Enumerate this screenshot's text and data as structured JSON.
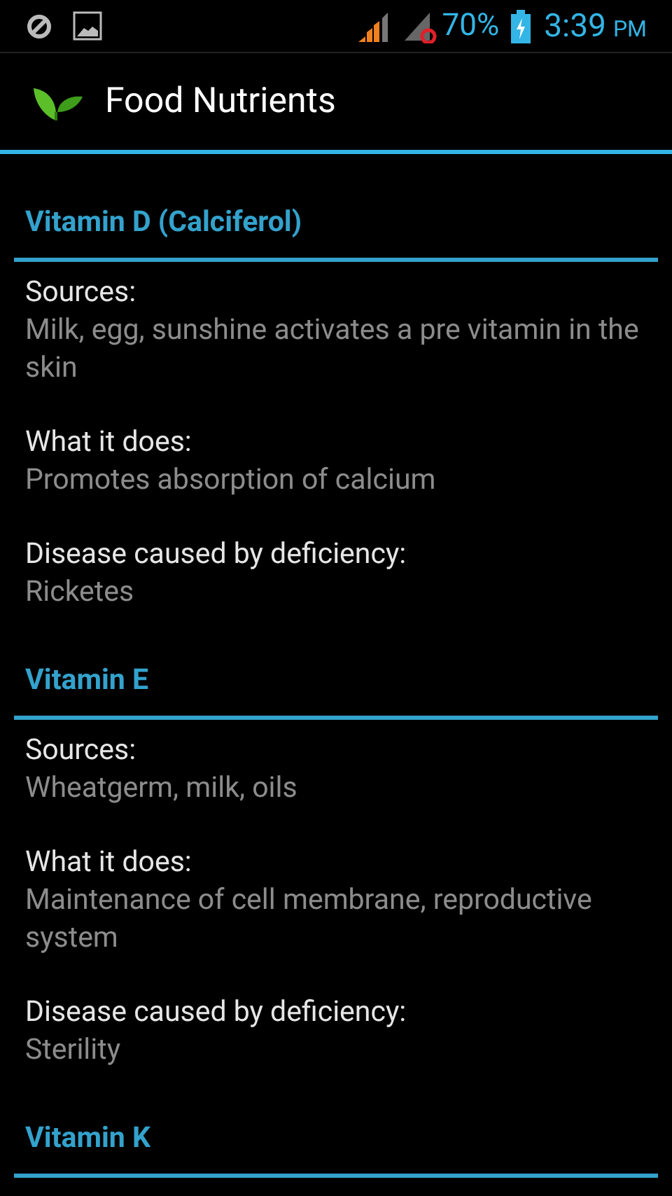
{
  "status_bar": {
    "battery": "70%",
    "time": "3:39",
    "ampm": "PM"
  },
  "action_bar": {
    "title": "Food Nutrients"
  },
  "sections": [
    {
      "title": "Vitamin D (Calciferol)",
      "items": [
        {
          "label": "Sources:",
          "value": "Milk, egg, sunshine activates a pre vitamin in the skin"
        },
        {
          "label": "What it does:",
          "value": "Promotes absorption of calcium"
        },
        {
          "label": "Disease caused by deficiency:",
          "value": "Ricketes"
        }
      ]
    },
    {
      "title": "Vitamin E",
      "items": [
        {
          "label": "Sources:",
          "value": "Wheatgerm, milk, oils"
        },
        {
          "label": "What it does:",
          "value": "Maintenance of cell membrane, reproductive system"
        },
        {
          "label": "Disease caused by deficiency:",
          "value": "Sterility"
        }
      ]
    },
    {
      "title": "Vitamin K"
    }
  ]
}
